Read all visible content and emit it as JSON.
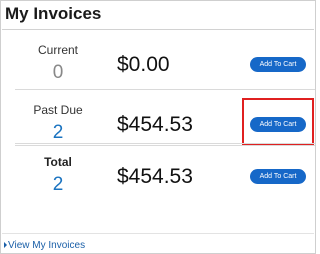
{
  "widget": {
    "title": "My Invoices",
    "rows": [
      {
        "label": "Current",
        "count": "0",
        "amount": "$0.00",
        "button": "Add To Cart"
      },
      {
        "label": "Past Due",
        "count": "2",
        "amount": "$454.53",
        "button": "Add To Cart"
      },
      {
        "label": "Total",
        "count": "2",
        "amount": "$454.53",
        "button": "Add To Cart"
      }
    ],
    "footer_link": "View My Invoices"
  },
  "colors": {
    "button": "#1668c8",
    "highlight": "#e02020",
    "count_blue": "#1a73c0",
    "link": "#1a5fa8"
  },
  "icons": {
    "footer_link_icon": "caret-right-icon"
  }
}
